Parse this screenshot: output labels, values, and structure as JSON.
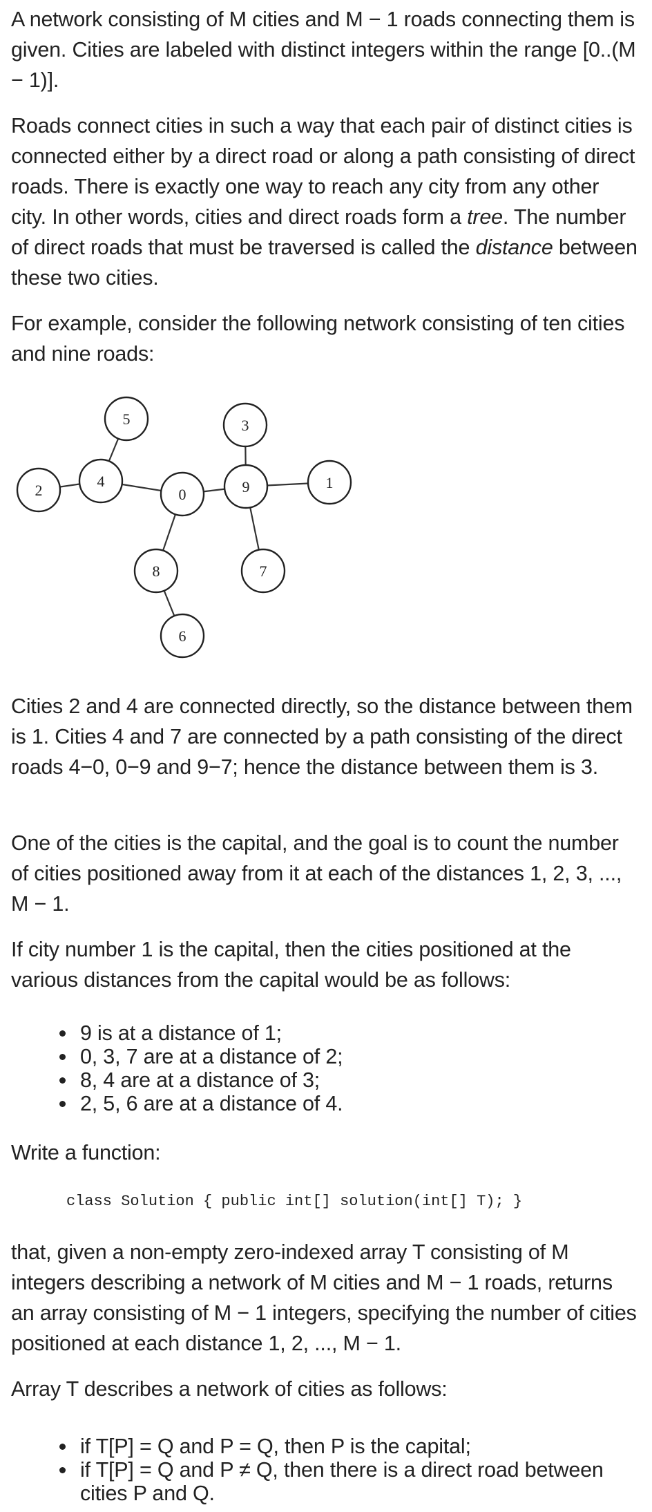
{
  "intro": {
    "p1": "A network consisting of M cities and M − 1 roads connecting them is given. Cities are labeled with distinct integers within the range [0..(M − 1)].",
    "p2_before_tree": "Roads connect cities in such a way that each pair of distinct cities is connected either by a direct road or along a path consisting of direct roads. There is exactly one way to reach any city from any other city. In other words, cities and direct roads form a ",
    "p2_tree": "tree",
    "p2_mid": ". The number of direct roads that must be traversed is called the ",
    "p2_distance": "distance",
    "p2_after": " between these two cities.",
    "p3": "For example, consider the following network consisting of ten cities and nine roads:"
  },
  "figure": {
    "nodes": [
      "0",
      "1",
      "2",
      "3",
      "4",
      "5",
      "6",
      "7",
      "8",
      "9"
    ],
    "edges": [
      [
        "2",
        "4"
      ],
      [
        "4",
        "5"
      ],
      [
        "4",
        "0"
      ],
      [
        "0",
        "8"
      ],
      [
        "8",
        "6"
      ],
      [
        "0",
        "9"
      ],
      [
        "9",
        "3"
      ],
      [
        "9",
        "1"
      ],
      [
        "9",
        "7"
      ]
    ]
  },
  "explanation": {
    "p4": "Cities 2 and 4 are connected directly, so the distance between them is 1. Cities 4 and 7 are connected by a path consisting of the direct roads 4−0, 0−9 and 9−7; hence the distance between them is 3.",
    "p5": "One of the cities is the capital, and the goal is to count the number of cities positioned away from it at each of the distances 1, 2, 3, ..., M − 1.",
    "p6": "If city number 1 is the capital, then the cities positioned at the various distances from the capital would be as follows:",
    "distance_list": [
      "9 is at a distance of 1;",
      "0, 3, 7 are at a distance of 2;",
      "8, 4 are at a distance of 3;",
      "2, 5, 6 are at a distance of 4."
    ]
  },
  "task": {
    "p7": "Write a function:",
    "signature": "class Solution { public int[] solution(int[] T); }",
    "p8": "that, given a non-empty zero-indexed array T consisting of M integers describing a network of M cities and M − 1 roads, returns an array consisting of M − 1 integers, specifying the number of cities positioned at each distance 1, 2, ..., M − 1.",
    "p9": "Array T describes a network of cities as follows:",
    "rules": [
      "if T[P] = Q and P = Q, then P is the capital;",
      "if T[P] = Q and P ≠ Q, then there is a direct road between cities P and Q."
    ]
  }
}
